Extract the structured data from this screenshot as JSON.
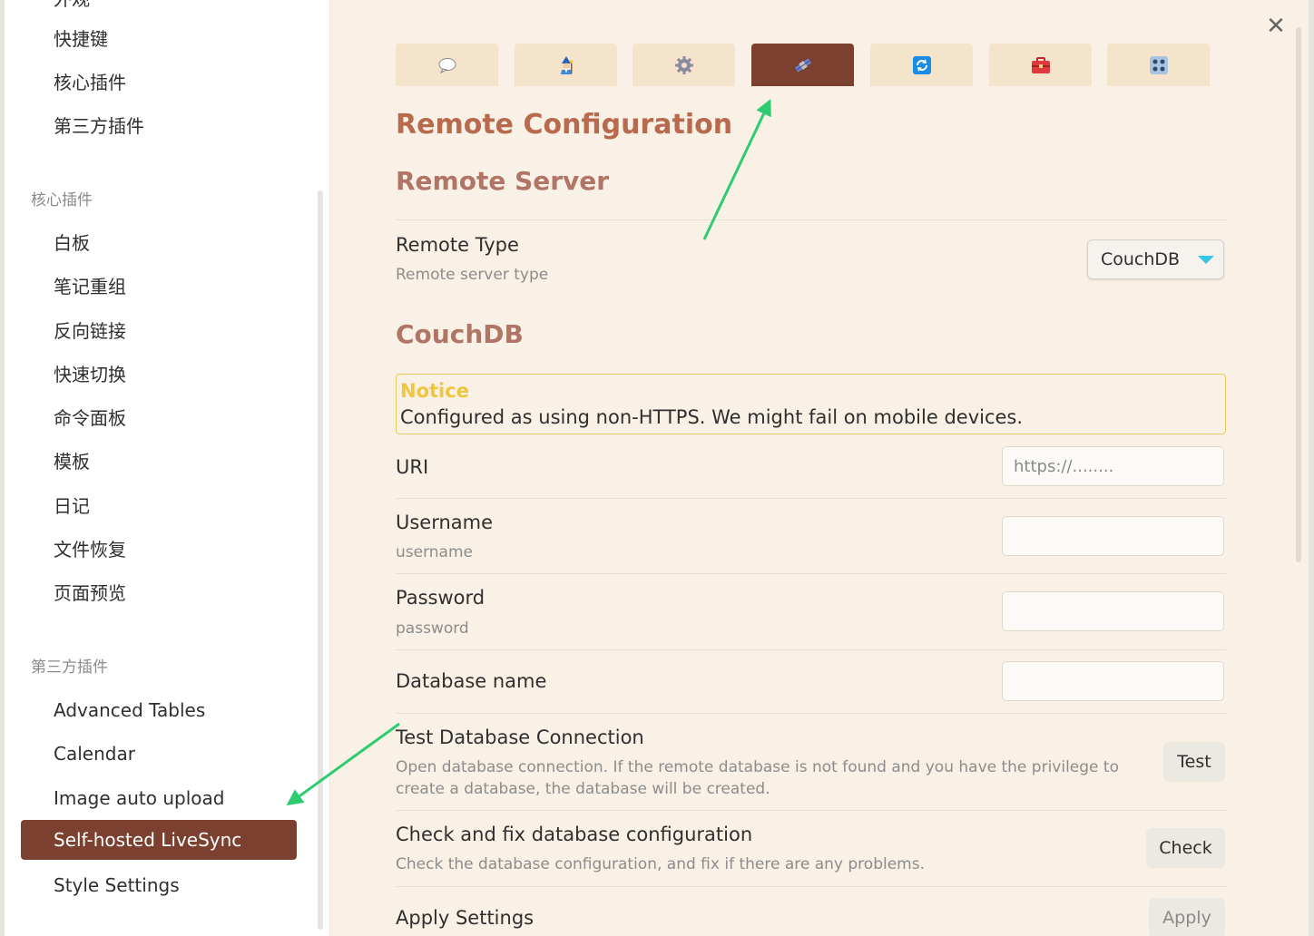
{
  "sidebar": {
    "top_items": [
      "快捷键",
      "核心插件",
      "第三方插件"
    ],
    "cut_item": "外观",
    "core_header": "核心插件",
    "core_items": [
      "白板",
      "笔记重组",
      "反向链接",
      "快速切换",
      "命令面板",
      "模板",
      "日记",
      "文件恢复",
      "页面预览"
    ],
    "third_header": "第三方插件",
    "third_items": [
      "Advanced Tables",
      "Calendar",
      "Image auto upload",
      "Self-hosted LiveSync",
      "Style Settings"
    ],
    "active_item": "Self-hosted LiveSync"
  },
  "tabs": [
    {
      "name": "chat-bubble-icon"
    },
    {
      "name": "wizard-icon"
    },
    {
      "name": "gear-icon"
    },
    {
      "name": "satellite-icon",
      "active": true
    },
    {
      "name": "sync-icon"
    },
    {
      "name": "toolbox-icon"
    },
    {
      "name": "control-panel-icon"
    }
  ],
  "page": {
    "title": "Remote Configuration",
    "remote_server_heading": "Remote Server",
    "remote_type": {
      "name": "Remote Type",
      "desc": "Remote server type",
      "value": "CouchDB"
    },
    "couchdb_heading": "CouchDB",
    "notice": {
      "title": "Notice",
      "message": "Configured as using non-HTTPS. We might fail on mobile devices."
    },
    "uri": {
      "name": "URI",
      "placeholder": "https://........"
    },
    "username": {
      "name": "Username",
      "desc": "username"
    },
    "password": {
      "name": "Password",
      "desc": "password"
    },
    "database": {
      "name": "Database name"
    },
    "test": {
      "name": "Test Database Connection",
      "desc": "Open database connection. If the remote database is not found and you have the privilege to create a database, the database will be created.",
      "button": "Test"
    },
    "check": {
      "name": "Check and fix database configuration",
      "desc": "Check the database configuration, and fix if there are any problems.",
      "button": "Check"
    },
    "apply": {
      "name": "Apply Settings",
      "button": "Apply"
    }
  },
  "colors": {
    "accent": "#7b4030",
    "heading": "#b86a4f",
    "annotation_arrow": "#2ecc71"
  }
}
